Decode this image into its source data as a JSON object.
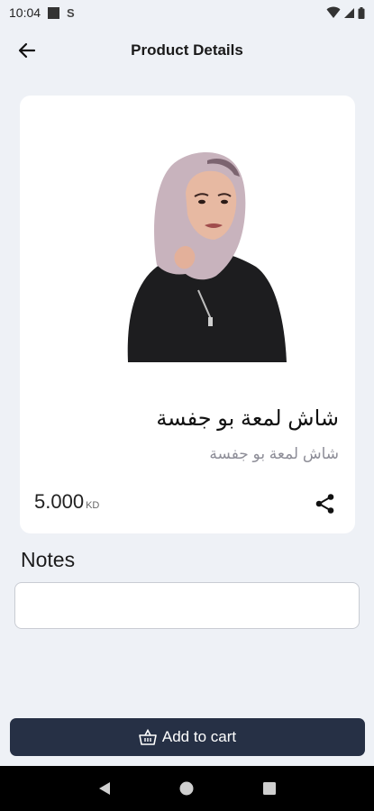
{
  "status_bar": {
    "time": "10:04"
  },
  "header": {
    "title": "Product Details"
  },
  "product": {
    "name": "شاش لمعة  بو جفسة",
    "subtitle": "شاش لمعة  بو جفسة",
    "price": "5.000",
    "currency": "KD"
  },
  "notes": {
    "label": "Notes",
    "placeholder": "",
    "value": ""
  },
  "actions": {
    "add_to_cart": "Add to cart"
  },
  "icons": {
    "back": "arrow-left-icon",
    "share": "share-icon",
    "cart": "basket-icon"
  },
  "colors": {
    "primary": "#263045",
    "background": "#eef1f6"
  }
}
